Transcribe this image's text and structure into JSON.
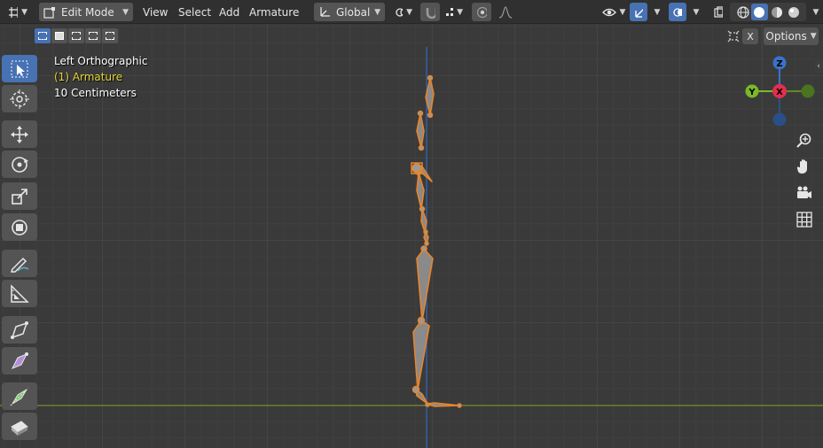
{
  "header": {
    "mode_label": "Edit Mode",
    "menus": [
      "View",
      "Select",
      "Add",
      "Armature"
    ],
    "transform_orientation": "Global"
  },
  "subbar": {
    "options_label": "Options",
    "x_label": "X"
  },
  "overlay": {
    "view_name": "Left Orthographic",
    "object_name": "(1) Armature",
    "grid_scale": "10 Centimeters"
  },
  "gizmo": {
    "z_label": "Z",
    "y_label": "Y",
    "x_label": "X"
  },
  "colors": {
    "accent": "#4772b3",
    "selection_orange": "#e8852a",
    "axis_z": "#3a72c9",
    "axis_y": "#7ab82a",
    "axis_x": "#e0304e",
    "overlay_yellow": "#e8d534"
  }
}
